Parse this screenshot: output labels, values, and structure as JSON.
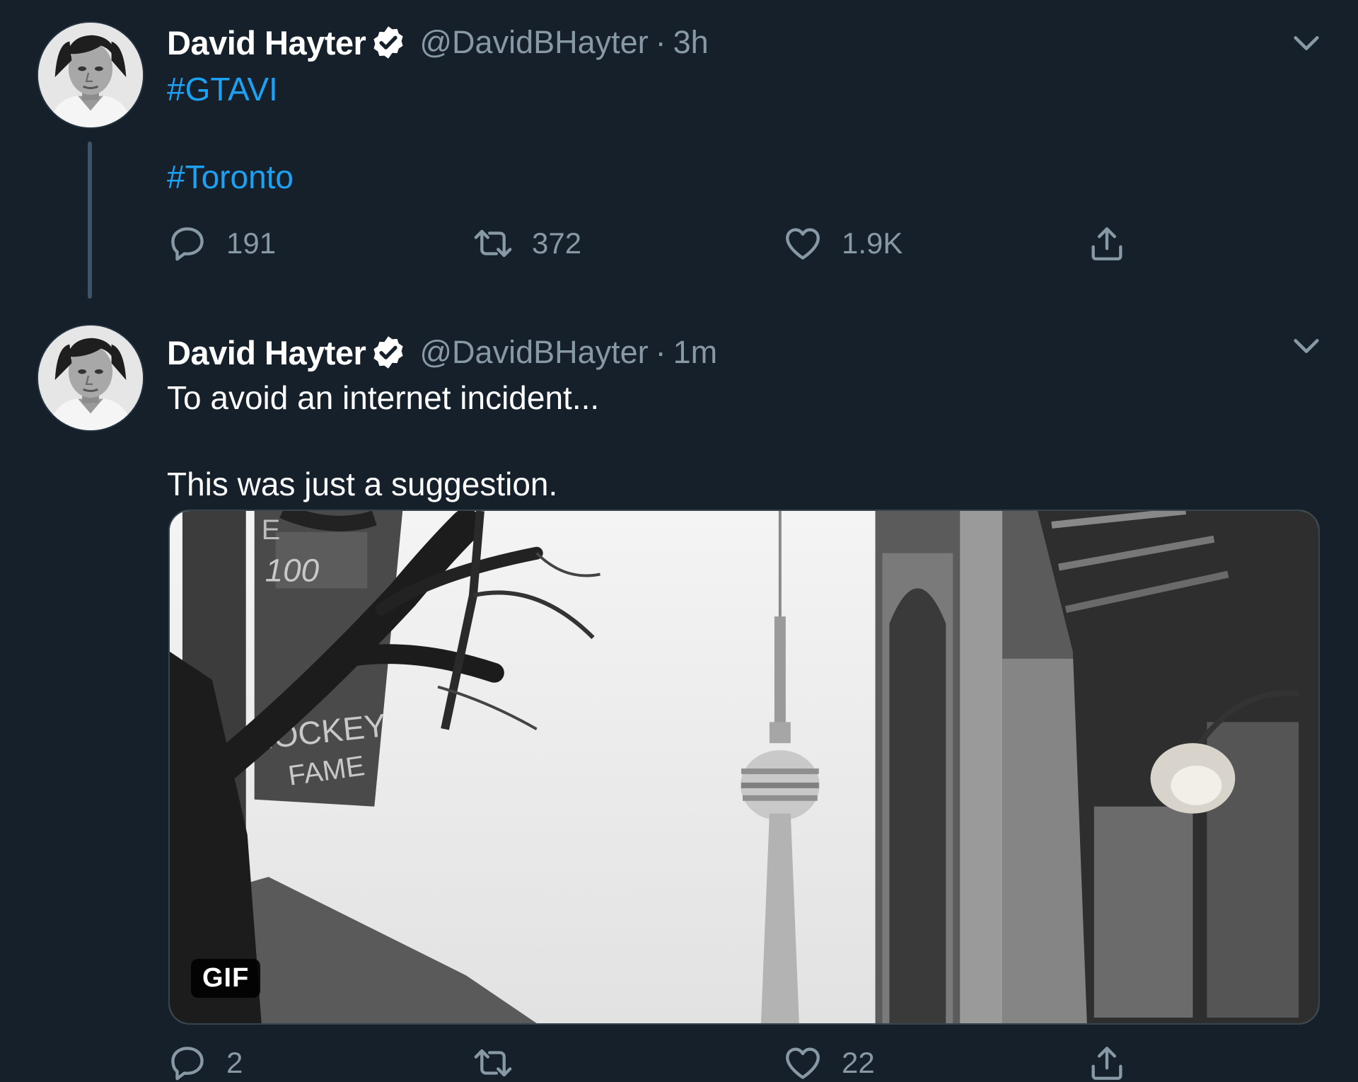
{
  "tweets": [
    {
      "display_name": "David Hayter",
      "handle": "@DavidBHayter",
      "separator": "·",
      "time": "3h",
      "lines": [
        "#GTAVI",
        "#Toronto"
      ],
      "reply_count": "191",
      "retweet_count": "372",
      "like_count": "1.9K"
    },
    {
      "display_name": "David Hayter",
      "handle": "@DavidBHayter",
      "separator": "·",
      "time": "1m",
      "lines": [
        "To avoid an internet incident...",
        "This was just a suggestion."
      ],
      "media": {
        "badge": "GIF",
        "banner_text_top": "E",
        "banner_text_mid": "100",
        "banner_text_hockey": "HOCKEY",
        "banner_text_fame": "FAME"
      },
      "reply_count": "2",
      "retweet_count": "",
      "like_count": "22"
    }
  ],
  "icons": {
    "verified": "verified-badge-icon",
    "caret": "chevron-down-icon",
    "reply": "reply-icon",
    "retweet": "retweet-icon",
    "like": "heart-icon",
    "share": "share-icon"
  },
  "colors": {
    "background": "#15202b",
    "hashtag": "#1da1f2",
    "secondary_text": "#8899a6",
    "thread_line": "#3d5466"
  }
}
